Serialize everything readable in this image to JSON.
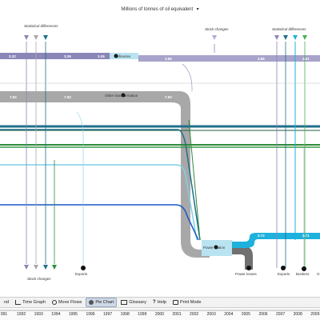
{
  "header": {
    "title": "Millions of tonnes of oil equivalent",
    "title_caret": "▾"
  },
  "diagram": {
    "labels": {
      "stat_diff_top_left": "Statistical differences",
      "stock_changes_top": "Stock changes",
      "stat_diff_top_right": "Statistical differences",
      "refineries": "Refineries",
      "other_transformation": "Other transformation",
      "power_station": "Power station",
      "stock_changes_bottom": "Stock changes",
      "exports_left": "Exports",
      "power_losses": "Power losses",
      "exports_right": "Exports",
      "bunkers": "Bunkers",
      "cut_label": "O"
    },
    "values": {
      "v1": "3.32",
      "v2": "3.26",
      "v3": "3.26",
      "v4": "3.85",
      "v5": "3.85",
      "v6": "3.01",
      "v7": "7.93",
      "v8": "7.93",
      "v9": "7.93",
      "v10": "3.72",
      "v11": "3.71"
    },
    "colors": {
      "purple": "#8a86b8",
      "gray": "#a8a8a8",
      "light_blue": "#7fd0e8",
      "teal": "#1f6f8b",
      "blue": "#1a58c8",
      "green": "#2e8b3a",
      "cyan": "#1eb1dc",
      "dark_gray": "#707070"
    }
  },
  "toolbar": {
    "items": [
      {
        "label": "nd",
        "icon": "legend-icon"
      },
      {
        "label": "Time Graph",
        "icon": "graph-icon"
      },
      {
        "label": "Move Flows",
        "icon": "move-icon"
      },
      {
        "label": "Pie Chart",
        "icon": "pie-chart-icon",
        "active": true
      },
      {
        "label": "Glossary",
        "icon": "glossary-icon"
      },
      {
        "label": "Help",
        "icon": "help-icon"
      },
      {
        "label": "Print Mode",
        "icon": "print-icon"
      }
    ]
  },
  "timeline": {
    "years": [
      "991",
      "1992",
      "1993",
      "1994",
      "1995",
      "1996",
      "1997",
      "1998",
      "1999",
      "2000",
      "2001",
      "2002",
      "2003",
      "2004",
      "2005",
      "2006",
      "2007",
      "2008",
      "2009"
    ]
  }
}
